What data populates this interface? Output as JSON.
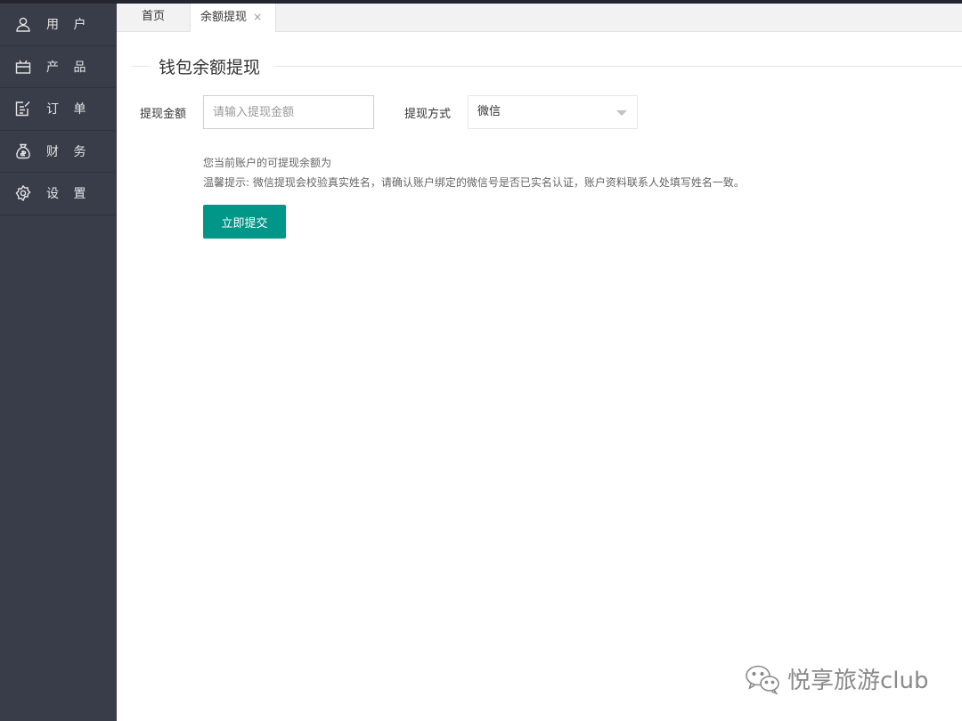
{
  "sidebar": {
    "items": [
      {
        "label": "用 户",
        "icon": "user-icon"
      },
      {
        "label": "产 品",
        "icon": "product-icon"
      },
      {
        "label": "订 单",
        "icon": "order-icon"
      },
      {
        "label": "财 务",
        "icon": "money-bag-icon"
      },
      {
        "label": "设 置",
        "icon": "gear-icon"
      }
    ]
  },
  "tabs": {
    "home": "首页",
    "active": "余额提现",
    "close_glyph": "×"
  },
  "form": {
    "title": "钱包余额提现",
    "amount_label": "提现金额",
    "amount_placeholder": "请输入提现金额",
    "amount_value": "",
    "method_label": "提现方式",
    "method_value": "微信",
    "balance_text": "您当前账户的可提现余额为",
    "tip_text": "温馨提示: 微信提现会校验真实姓名，请确认账户绑定的微信号是否已实名认证，账户资料联系人处填写姓名一致。",
    "submit_label": "立即提交"
  },
  "watermark": {
    "text": "悦享旅游club",
    "icon": "wechat-icon"
  },
  "colors": {
    "sidebar_bg": "#393d49",
    "accent": "#009688",
    "topbar": "#23262e"
  }
}
